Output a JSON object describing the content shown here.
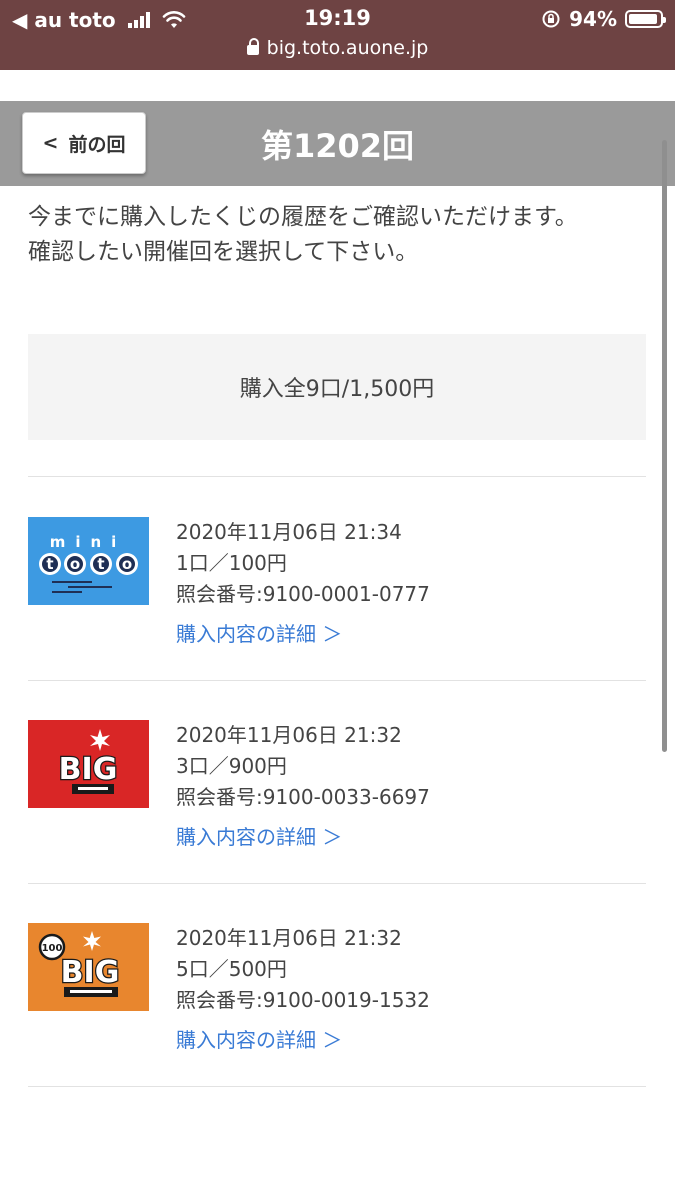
{
  "status_bar": {
    "back_app": "◀ au toto",
    "time": "19:19",
    "battery_percent": "94%",
    "battery_level": 0.94,
    "url": "big.toto.auone.jp"
  },
  "header": {
    "back_label": "前の回",
    "title": "第1202回"
  },
  "intro": {
    "line1": "今までに購入したくじの履歴をご確認いただけます。",
    "line2": "確認したい開催回を選択して下さい。"
  },
  "summary": {
    "text": "購入全9口/1,500円"
  },
  "tickets": [
    {
      "logo": "mini-toto-logo",
      "logo_text": "minitoto",
      "datetime": "2020年11月06日 21:34",
      "units": "1口／100円",
      "ref": "照会番号:9100-0001-0777",
      "link": "購入内容の詳細 ＞",
      "color": "#3d9ae2"
    },
    {
      "logo": "big-logo",
      "logo_text": "BIG ビッグ",
      "datetime": "2020年11月06日 21:32",
      "units": "3口／900円",
      "ref": "照会番号:9100-0033-6697",
      "link": "購入内容の詳細 ＞",
      "color": "#d92626"
    },
    {
      "logo": "big-100-logo",
      "logo_text": "100 BIG 100円ビッグ",
      "datetime": "2020年11月06日 21:32",
      "units": "5口／500円",
      "ref": "照会番号:9100-0019-1532",
      "link": "購入内容の詳細 ＞",
      "color": "#e8862e"
    }
  ]
}
